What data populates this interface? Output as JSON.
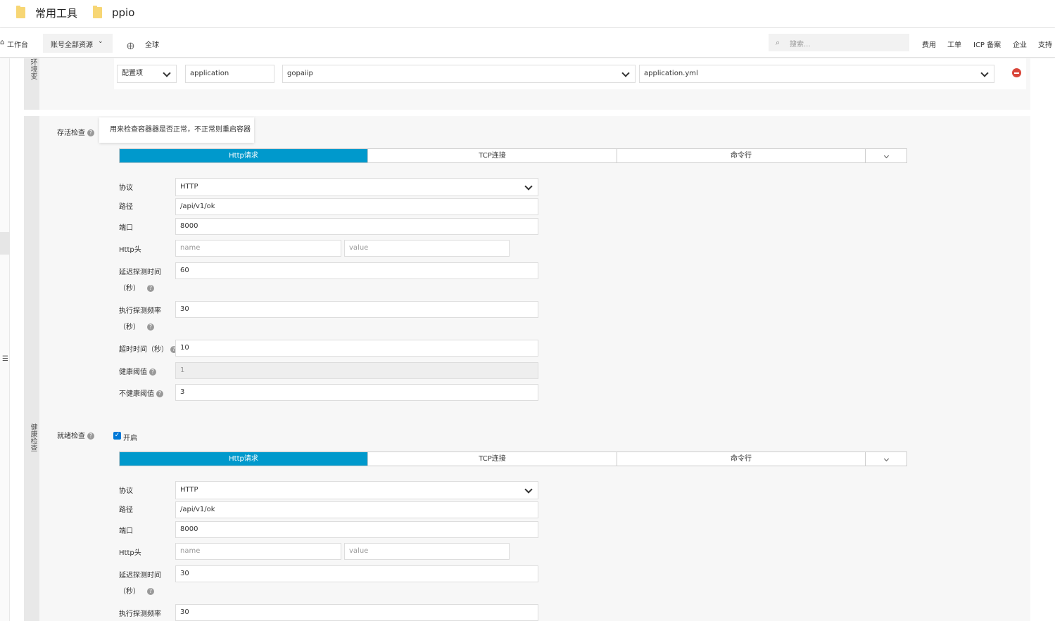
{
  "bookmarks": [
    {
      "label": "常用工具",
      "icon": "folder-icon"
    },
    {
      "label": "ppio",
      "icon": "folder-icon"
    }
  ],
  "topnav": {
    "workbench": "工作台",
    "account_resources": "账号全部资源",
    "region": "全球",
    "search_placeholder": "搜索...",
    "links": [
      "费用",
      "工单",
      "ICP 备案",
      "企业",
      "支持"
    ]
  },
  "config_row": {
    "section_label": "环境变",
    "type": "配置项",
    "name": "application",
    "config_map": "gopaiip",
    "key": "application.yml"
  },
  "health_section_label": "健康检查",
  "liveness": {
    "label": "存活检查",
    "tooltip": "用来检查容器器是否正常，不正常则重启容器",
    "tabs": [
      "Http请求",
      "TCP连接",
      "命令行"
    ],
    "fields": {
      "protocol_label": "协议",
      "protocol": "HTTP",
      "path_label": "路径",
      "path": "/api/v1/ok",
      "port_label": "端口",
      "port": "8000",
      "header_label": "Http头",
      "header_name_ph": "name",
      "header_value_ph": "value",
      "delay_label": "延迟探测时间",
      "delay_unit": "（秒）",
      "delay": "60",
      "period_label": "执行探测频率",
      "period_unit": "（秒）",
      "period": "30",
      "timeout_label": "超时时间（秒）",
      "timeout": "10",
      "healthy_label": "健康阈值",
      "healthy": "1",
      "unhealthy_label": "不健康阈值",
      "unhealthy": "3"
    }
  },
  "readiness": {
    "label": "就绪检查",
    "enable_label": "开启",
    "enabled": true,
    "tabs": [
      "Http请求",
      "TCP连接",
      "命令行"
    ],
    "fields": {
      "protocol_label": "协议",
      "protocol": "HTTP",
      "path_label": "路径",
      "path": "/api/v1/ok",
      "port_label": "端口",
      "port": "8000",
      "header_label": "Http头",
      "header_name_ph": "name",
      "header_value_ph": "value",
      "delay_label": "延迟探测时间",
      "delay_unit": "（秒）",
      "delay": "30",
      "period_label": "执行探测频率",
      "period": "30"
    }
  },
  "colors": {
    "accent": "#0099cc",
    "danger": "#d9463a",
    "folder": "#f7d674"
  }
}
